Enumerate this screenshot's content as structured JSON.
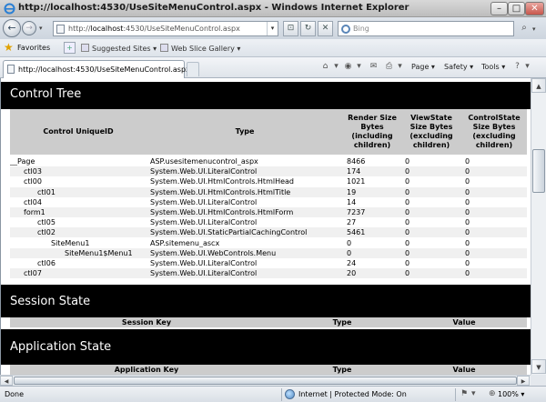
{
  "window": {
    "title": "http://localhost:4530/UseSiteMenuControl.aspx - Windows Internet Explorer",
    "minimize": "–",
    "maximize": "□",
    "close": "✕"
  },
  "address": {
    "url_prefix": "http://",
    "url_host": "localhost",
    "url_rest": ":4530/UseSiteMenuControl.aspx",
    "search_placeholder": "Bing"
  },
  "favorites": {
    "label": "Favorites",
    "links": [
      "Suggested Sites ▾",
      "Web Slice Gallery ▾"
    ]
  },
  "tab": {
    "title": "http://localhost:4530/UseSiteMenuControl.aspx"
  },
  "commands": {
    "page": "Page ▾",
    "safety": "Safety ▾",
    "tools": "Tools ▾"
  },
  "control_tree": {
    "heading": "Control Tree",
    "columns": {
      "id": "Control UniqueID",
      "type": "Type",
      "render": "Render Size Bytes (including children)",
      "viewstate": "ViewState Size Bytes (excluding children)",
      "controlstate": "ControlState Size Bytes (excluding children)"
    },
    "rows": [
      {
        "id": "__Page",
        "indent": 0,
        "type": "ASP.usesitemenucontrol_aspx",
        "render": "8466",
        "viewstate": "0",
        "controlstate": "0"
      },
      {
        "id": "ctl03",
        "indent": 1,
        "type": "System.Web.UI.LiteralControl",
        "render": "174",
        "viewstate": "0",
        "controlstate": "0"
      },
      {
        "id": "ctl00",
        "indent": 1,
        "type": "System.Web.UI.HtmlControls.HtmlHead",
        "render": "1021",
        "viewstate": "0",
        "controlstate": "0"
      },
      {
        "id": "ctl01",
        "indent": 2,
        "type": "System.Web.UI.HtmlControls.HtmlTitle",
        "render": "19",
        "viewstate": "0",
        "controlstate": "0"
      },
      {
        "id": "ctl04",
        "indent": 1,
        "type": "System.Web.UI.LiteralControl",
        "render": "14",
        "viewstate": "0",
        "controlstate": "0"
      },
      {
        "id": "form1",
        "indent": 1,
        "type": "System.Web.UI.HtmlControls.HtmlForm",
        "render": "7237",
        "viewstate": "0",
        "controlstate": "0"
      },
      {
        "id": "ctl05",
        "indent": 2,
        "type": "System.Web.UI.LiteralControl",
        "render": "27",
        "viewstate": "0",
        "controlstate": "0"
      },
      {
        "id": "ctl02",
        "indent": 2,
        "type": "System.Web.UI.StaticPartialCachingControl",
        "render": "5461",
        "viewstate": "0",
        "controlstate": "0"
      },
      {
        "id": "SiteMenu1",
        "indent": 3,
        "type": "ASP.sitemenu_ascx",
        "render": "0",
        "viewstate": "0",
        "controlstate": "0"
      },
      {
        "id": "SiteMenu1$Menu1",
        "indent": 4,
        "type": "System.Web.UI.WebControls.Menu",
        "render": "0",
        "viewstate": "0",
        "controlstate": "0"
      },
      {
        "id": "ctl06",
        "indent": 2,
        "type": "System.Web.UI.LiteralControl",
        "render": "24",
        "viewstate": "0",
        "controlstate": "0"
      },
      {
        "id": "ctl07",
        "indent": 1,
        "type": "System.Web.UI.LiteralControl",
        "render": "20",
        "viewstate": "0",
        "controlstate": "0"
      }
    ]
  },
  "session_state": {
    "heading": "Session State",
    "columns": {
      "key": "Session Key",
      "type": "Type",
      "value": "Value"
    }
  },
  "application_state": {
    "heading": "Application State",
    "columns": {
      "key": "Application Key",
      "type": "Type",
      "value": "Value"
    }
  },
  "status": {
    "text": "Done",
    "zone": "Internet | Protected Mode: On",
    "zoom": "100%"
  }
}
